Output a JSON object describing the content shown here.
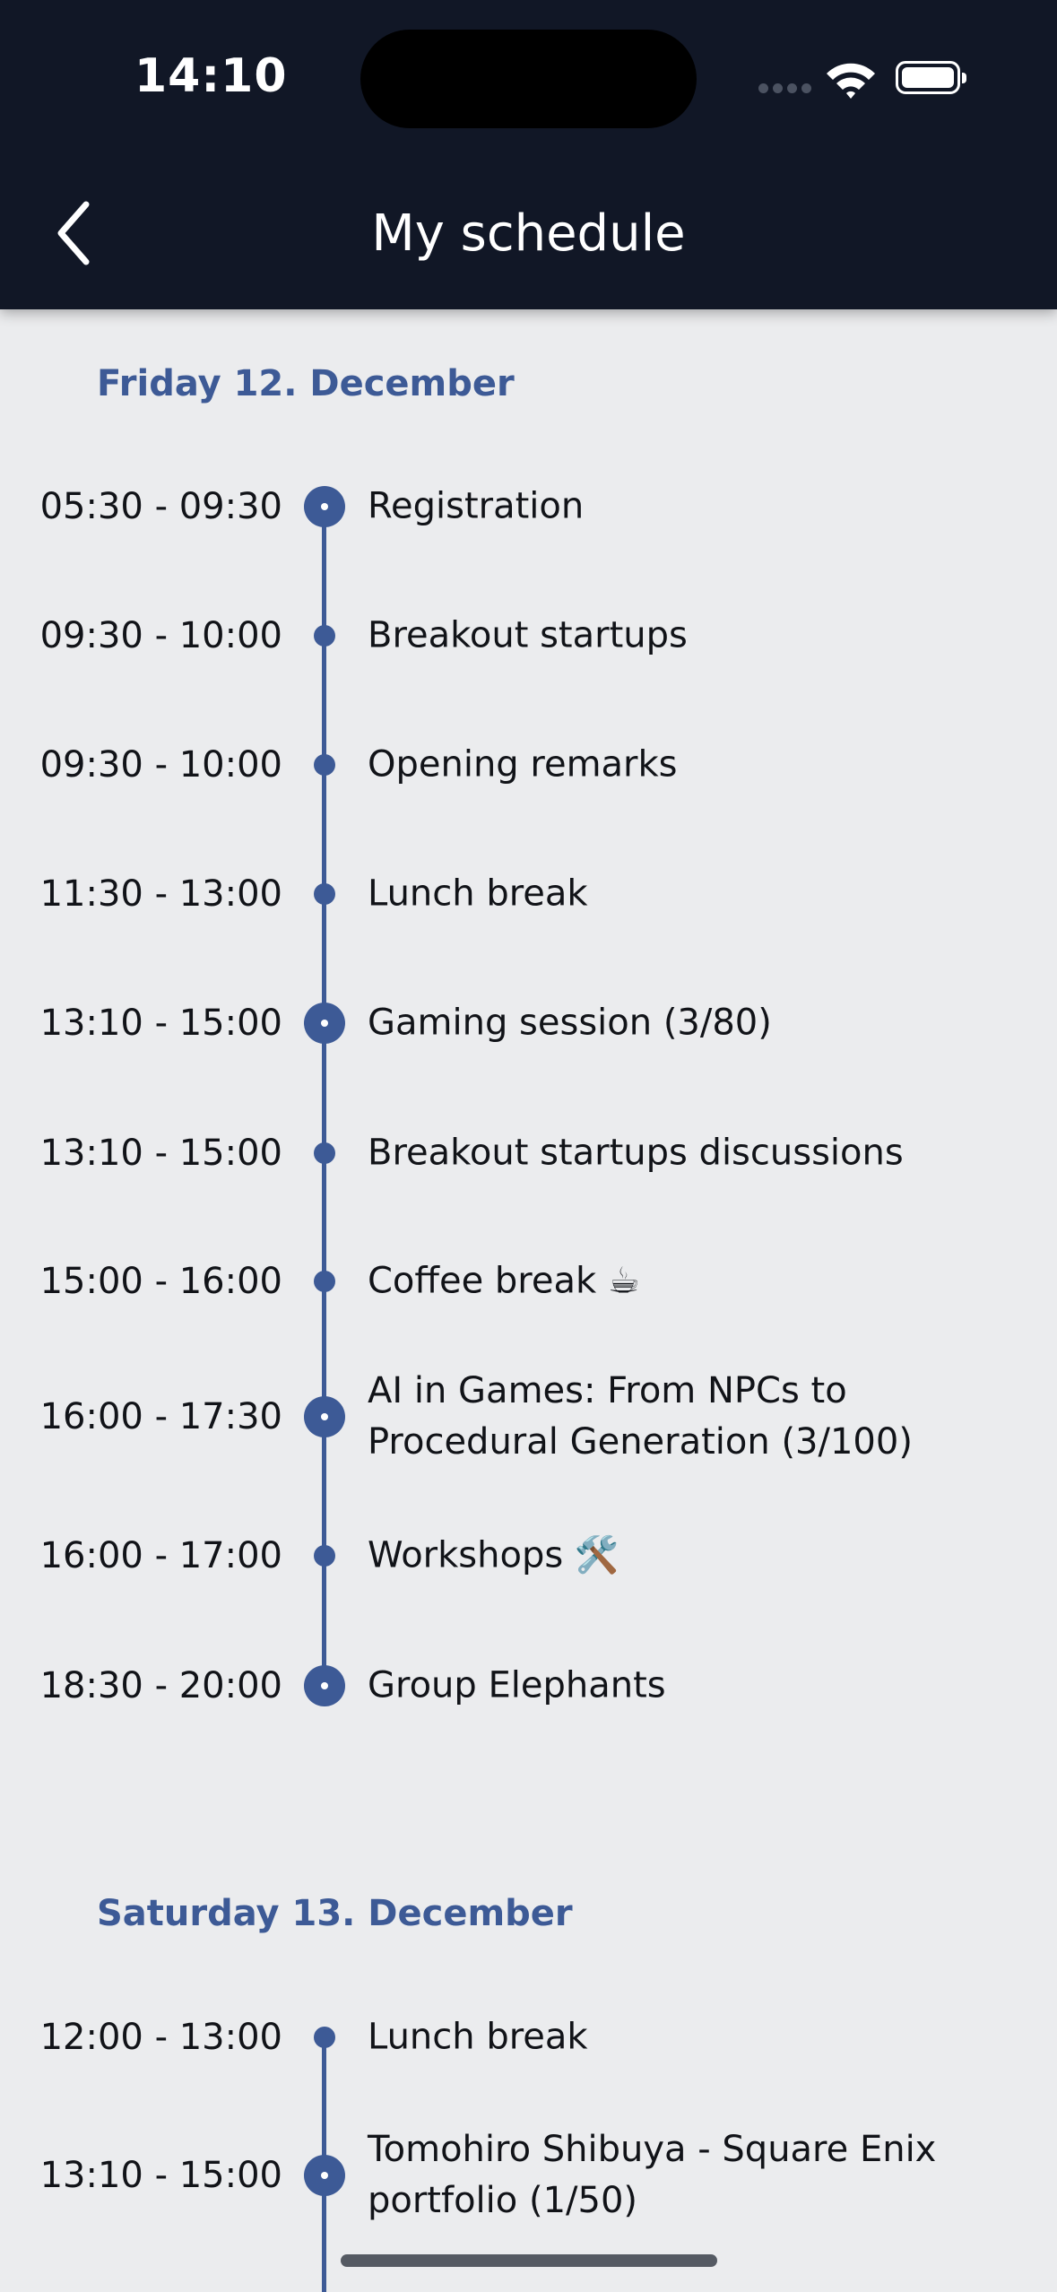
{
  "status_bar": {
    "time": "14:10"
  },
  "header": {
    "title": "My schedule",
    "back_icon": "chevron-left-icon"
  },
  "days": [
    {
      "heading": "Friday 12. December",
      "events": [
        {
          "time": "05:30 - 09:30",
          "title": "Registration",
          "marker": "big"
        },
        {
          "time": "09:30 - 10:00",
          "title": "Breakout startups",
          "marker": "small"
        },
        {
          "time": "09:30 - 10:00",
          "title": "Opening remarks",
          "marker": "small"
        },
        {
          "time": "11:30 - 13:00",
          "title": "Lunch break",
          "marker": "small"
        },
        {
          "time": "13:10 - 15:00",
          "title": "Gaming session (3/80)",
          "marker": "big"
        },
        {
          "time": "13:10 - 15:00",
          "title": "Breakout startups discussions",
          "marker": "small"
        },
        {
          "time": "15:00 - 16:00",
          "title": "Coffee break ☕",
          "marker": "small"
        },
        {
          "time": "16:00 - 17:30",
          "title": "AI in Games: From NPCs to Procedural Generation (3/100)",
          "marker": "big"
        },
        {
          "time": "16:00 - 17:00",
          "title": "Workshops 🛠️",
          "marker": "small"
        },
        {
          "time": "18:30 - 20:00",
          "title": "Group Elephants",
          "marker": "big"
        }
      ]
    },
    {
      "heading": "Saturday 13. December",
      "events": [
        {
          "time": "12:00 - 13:00",
          "title": "Lunch break",
          "marker": "small"
        },
        {
          "time": "13:10 - 15:00",
          "title": "Tomohiro Shibuya - Square Enix portfolio (1/50)",
          "marker": "big"
        }
      ]
    }
  ]
}
